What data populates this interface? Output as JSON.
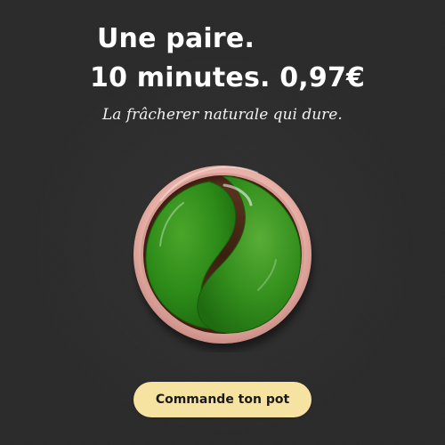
{
  "headline": {
    "line1": "Une paire.",
    "line2": "10 minutes. 0,97€"
  },
  "tagline": "La frâcherer naturale qui dure.",
  "cta": {
    "label": "Commande ton pot"
  },
  "colors": {
    "background": "#2b2b2b",
    "headline_text": "#ffffff",
    "cta_background": "#f7e3a1",
    "cta_text": "#1a1a1a",
    "jar_rim": "#e9b8b0",
    "patch_green": "#2f8a1e"
  },
  "product": {
    "name": "green-eye-patch-jar"
  }
}
